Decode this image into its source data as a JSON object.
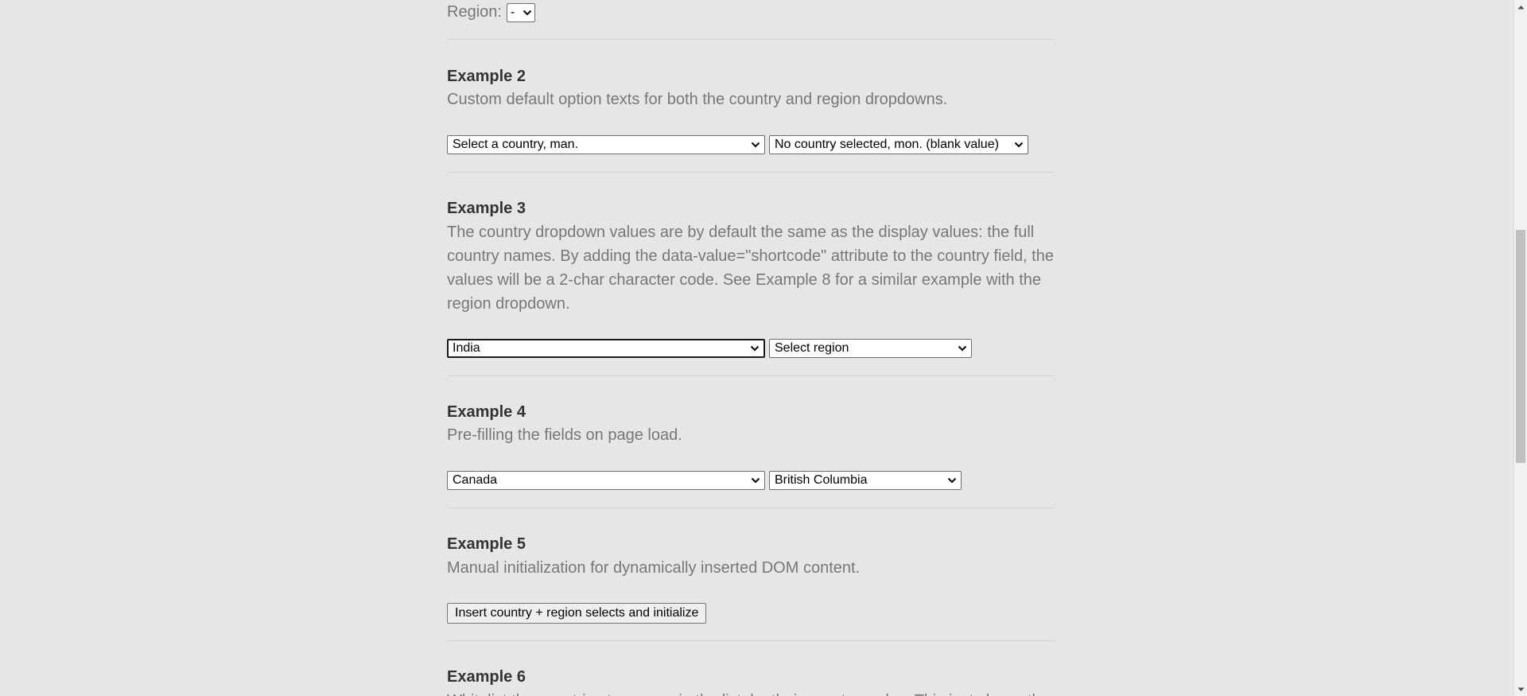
{
  "example1": {
    "region_label": "Region:",
    "region_select_value": "-"
  },
  "example2": {
    "title": "Example 2",
    "description": "Custom default option texts for both the country and region dropdowns.",
    "country_select_value": "Select a country, man.",
    "region_select_value": "No country selected, mon. (blank value)"
  },
  "example3": {
    "title": "Example 3",
    "description": "The country dropdown values are by default the same as the display values: the full country names. By adding the data-value=\"shortcode\" attribute to the country field, the values will be a 2-char character code. See Example 8 for a similar example with the region dropdown.",
    "country_select_value": "India",
    "region_select_value": "Select region"
  },
  "example4": {
    "title": "Example 4",
    "description": "Pre-filling the fields on page load.",
    "country_select_value": "Canada",
    "region_select_value": "British Columbia"
  },
  "example5": {
    "title": "Example 5",
    "description": "Manual initialization for dynamically inserted DOM content.",
    "button_label": "Insert country + region selects and initialize"
  },
  "example6": {
    "title": "Example 6",
    "description_partial": "Whitelist the countries to appear in the list, by their country codes. This just shows the UK, United"
  },
  "icons": {
    "select_arrow": "chevron-down-icon",
    "scroll_up": "scroll-up-arrow-icon",
    "scroll_down": "scroll-down-arrow-icon"
  },
  "colors": {
    "background": "#e6e6e6",
    "title_text": "#333333",
    "description_text": "#777777",
    "divider": "#d3d3d3"
  }
}
